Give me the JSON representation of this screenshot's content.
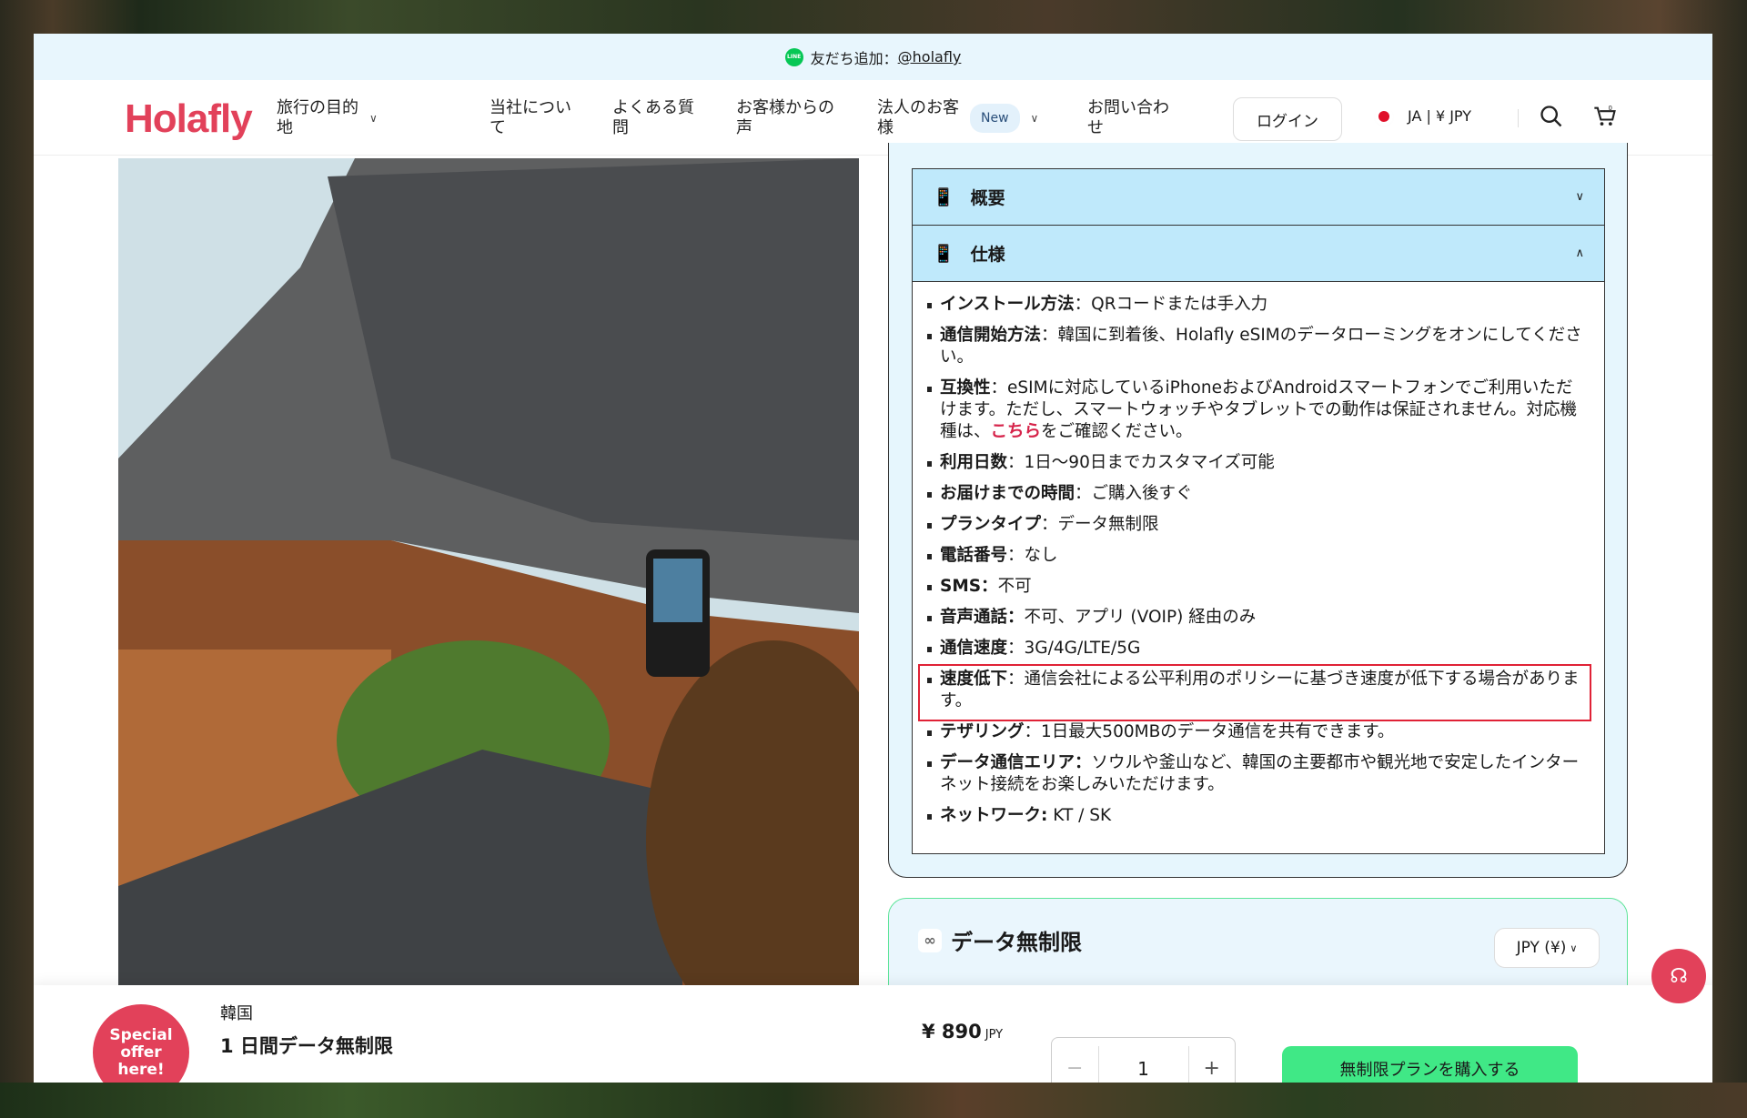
{
  "banner": {
    "text": "友だち追加：",
    "handle": "@holafly",
    "icon": "line-icon"
  },
  "nav": {
    "logo": "Holafly",
    "items": [
      {
        "label": "旅行の目的\n地",
        "dropdown": true
      },
      {
        "label": "当社につい\nて"
      },
      {
        "label": "よくある質\n問"
      },
      {
        "label": "お客様からの\n声"
      },
      {
        "label": "法人のお客\n様",
        "badge": "New",
        "dropdown": true
      },
      {
        "label": "お問い合わ\nせ"
      }
    ],
    "login": "ログイン",
    "locale": "JA | ¥ JPY",
    "cart_count": "0"
  },
  "accordion": {
    "overview": "概要",
    "specs": "仕様",
    "items": [
      {
        "label": "インストール方法",
        "sep": "：",
        "value": "QRコードまたは手入力"
      },
      {
        "label": "通信開始方法",
        "sep": "：",
        "value": "韓国に到着後、Holafly eSIMのデータローミングをオンにしてください。"
      },
      {
        "label": "互換性",
        "sep": "：",
        "value": "eSIMに対応しているiPhoneおよびAndroidスマートフォンでご利用いただけます。ただし、スマートウォッチやタブレットでの動作は保証されません。対応機種は、",
        "link": "こちら",
        "value_after": "をご確認ください。"
      },
      {
        "label": "利用日数",
        "sep": "：",
        "value": "1日〜90日までカスタマイズ可能"
      },
      {
        "label": "お届けまでの時間",
        "sep": "：",
        "value": "ご購入後すぐ"
      },
      {
        "label": "プランタイプ",
        "sep": "：",
        "value": "データ無制限"
      },
      {
        "label": "電話番号",
        "sep": "：",
        "value": "なし"
      },
      {
        "label": "SMS：",
        "sep": "",
        "value": "不可"
      },
      {
        "label": "音声通話：",
        "sep": "",
        "value": "不可、アプリ (VOIP) 経由のみ"
      },
      {
        "label": "通信速度",
        "sep": "：",
        "value": "3G/4G/LTE/5G"
      },
      {
        "label": "速度低下",
        "sep": "：",
        "value": "通信会社による公平利用のポリシーに基づき速度が低下する場合があります。",
        "highlighted": true
      },
      {
        "label": "テザリング",
        "sep": "：",
        "value": "1日最大500MBのデータ通信を共有できます。"
      },
      {
        "label": "データ通信エリア：",
        "sep": "",
        "value": "ソウルや釜山など、韓国の主要都市や観光地で安定したインターネット接続をお楽しみいただけます。"
      },
      {
        "label": "ネットワーク:",
        "sep": "",
        "value": " KT / SK"
      }
    ]
  },
  "plan": {
    "title": "データ無制限",
    "currency": "JPY (¥)"
  },
  "bottom": {
    "special": "Special\noffer\nhere!",
    "country": "韓国",
    "title": "1 日間データ無制限",
    "price": "¥ 890",
    "price_unit": "JPY",
    "qty": "1",
    "minus": "−",
    "plus": "+",
    "buy": "無制限プランを購入する"
  },
  "colors": {
    "brand": "#e2415a",
    "accent_green": "#40e886",
    "accordion_header": "#bfe9fb",
    "highlight": "#e02236"
  }
}
